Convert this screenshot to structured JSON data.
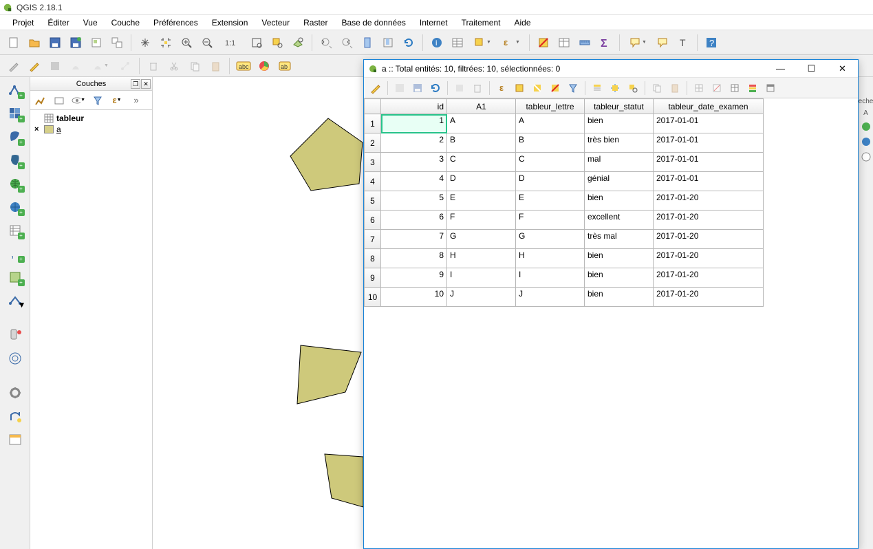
{
  "app": {
    "title": "QGIS 2.18.1"
  },
  "menu": [
    "Projet",
    "Éditer",
    "Vue",
    "Couche",
    "Préférences",
    "Extension",
    "Vecteur",
    "Raster",
    "Base de données",
    "Internet",
    "Traitement",
    "Aide"
  ],
  "layers_panel": {
    "title": "Couches",
    "items": [
      {
        "name": "tableur",
        "type": "table",
        "bold": true
      },
      {
        "name": "a",
        "type": "polygon",
        "underline": true
      }
    ]
  },
  "right_sliver": {
    "label1": "eche",
    "label2": "A"
  },
  "attr_window": {
    "title": "a :: Total entités: 10, filtrées: 10, sélectionnées: 0",
    "columns": [
      "id",
      "A1",
      "tableur_lettre",
      "tableur_statut",
      "tableur_date_examen"
    ],
    "rows": [
      {
        "n": "1",
        "id": "1",
        "a1": "A",
        "lettre": "A",
        "statut": "bien",
        "date": "2017-01-01"
      },
      {
        "n": "2",
        "id": "2",
        "a1": "B",
        "lettre": "B",
        "statut": "très bien",
        "date": "2017-01-01"
      },
      {
        "n": "3",
        "id": "3",
        "a1": "C",
        "lettre": "C",
        "statut": "mal",
        "date": "2017-01-01"
      },
      {
        "n": "4",
        "id": "4",
        "a1": "D",
        "lettre": "D",
        "statut": "génial",
        "date": "2017-01-01"
      },
      {
        "n": "5",
        "id": "5",
        "a1": "E",
        "lettre": "E",
        "statut": "bien",
        "date": "2017-01-20"
      },
      {
        "n": "6",
        "id": "6",
        "a1": "F",
        "lettre": "F",
        "statut": "excellent",
        "date": "2017-01-20"
      },
      {
        "n": "7",
        "id": "7",
        "a1": "G",
        "lettre": "G",
        "statut": "très mal",
        "date": "2017-01-20"
      },
      {
        "n": "8",
        "id": "8",
        "a1": "H",
        "lettre": "H",
        "statut": "bien",
        "date": "2017-01-20"
      },
      {
        "n": "9",
        "id": "9",
        "a1": "I",
        "lettre": "I",
        "statut": "bien",
        "date": "2017-01-20"
      },
      {
        "n": "10",
        "id": "10",
        "a1": "J",
        "lettre": "J",
        "statut": "bien",
        "date": "2017-01-20"
      }
    ]
  }
}
